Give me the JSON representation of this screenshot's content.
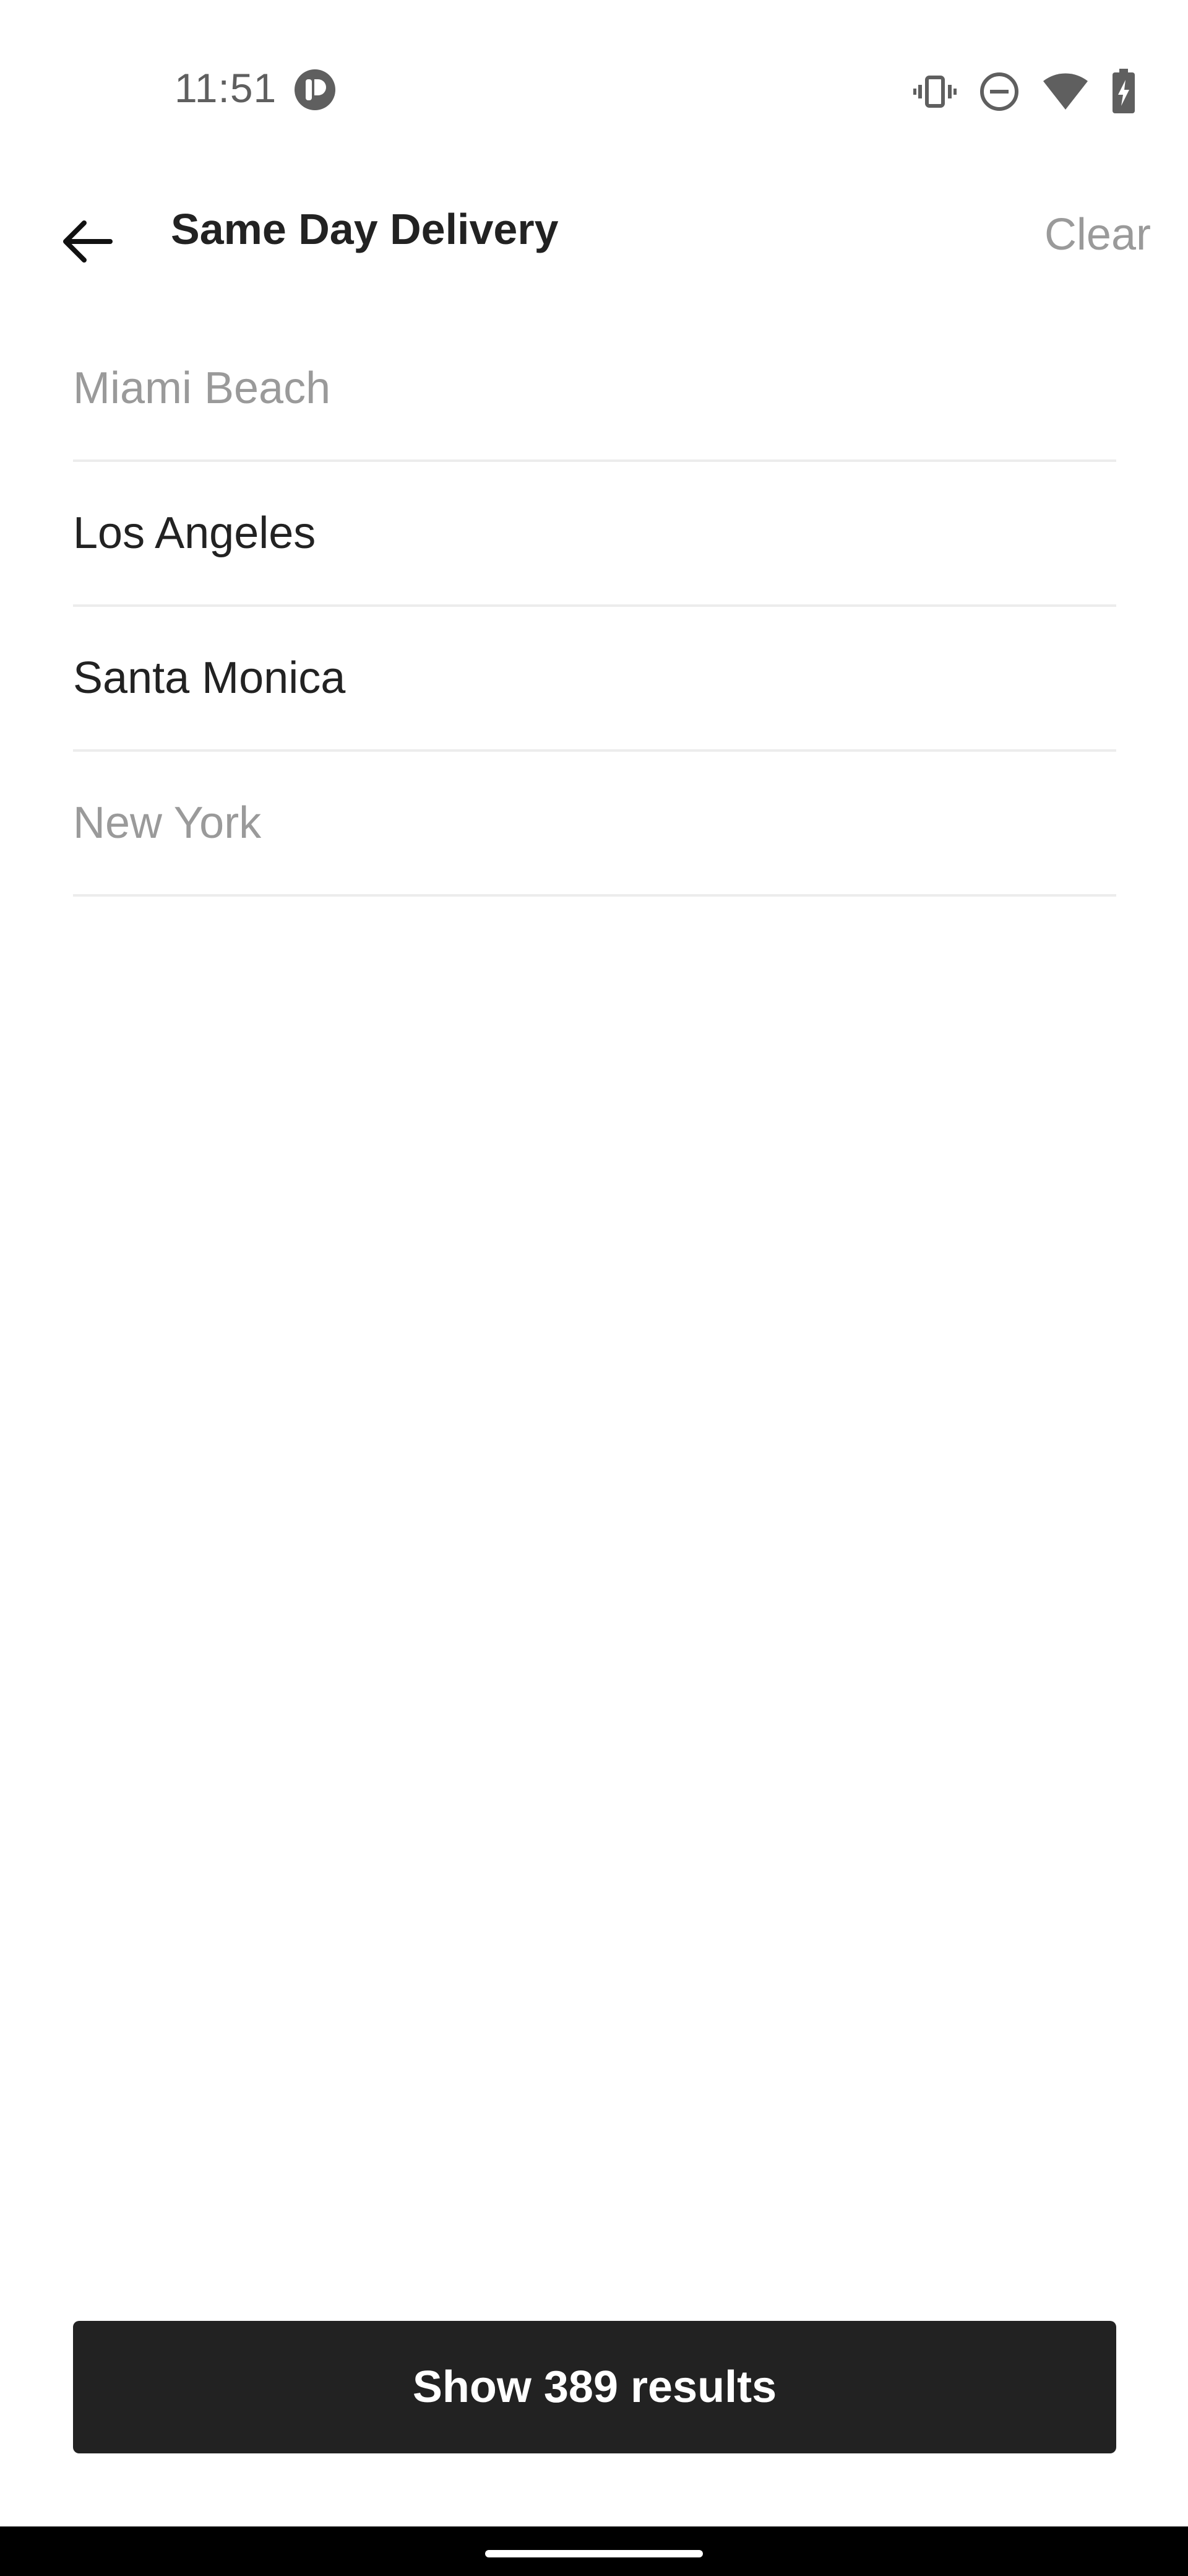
{
  "status_bar": {
    "time": "11:51",
    "icons": [
      "app-notification-icon",
      "vibrate-icon",
      "do-not-disturb-icon",
      "wifi-icon",
      "battery-charging-icon"
    ]
  },
  "toolbar": {
    "back_icon": "arrow-left-icon",
    "title": "Same Day Delivery",
    "clear_label": "Clear"
  },
  "cities": [
    {
      "label": "Miami Beach",
      "enabled": false
    },
    {
      "label": "Los Angeles",
      "enabled": true
    },
    {
      "label": "Santa Monica",
      "enabled": true
    },
    {
      "label": "New York",
      "enabled": false
    }
  ],
  "footer": {
    "results_button_label": "Show 389 results"
  },
  "colors": {
    "primary_text": "#222222",
    "disabled_text": "#9a9a9a",
    "button_background": "#222222",
    "button_text": "#ffffff",
    "divider": "#ececec"
  }
}
